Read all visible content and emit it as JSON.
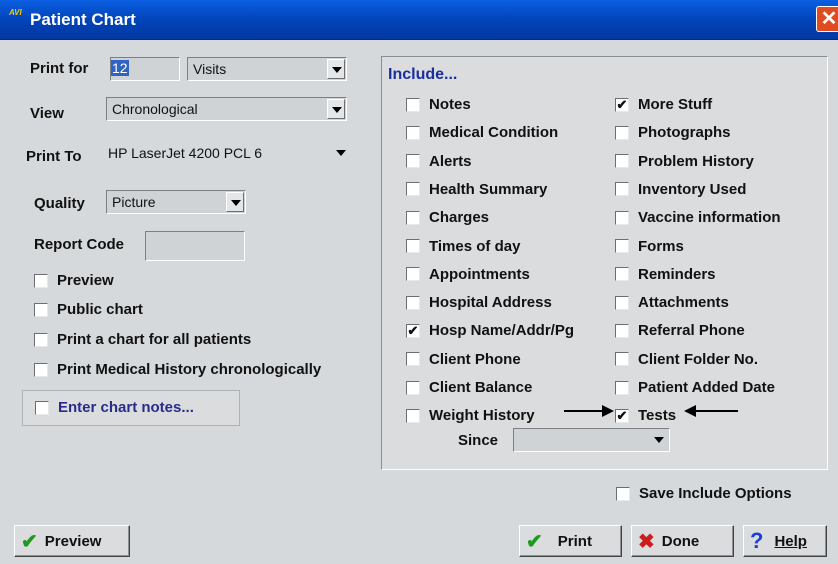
{
  "window": {
    "title": "Patient Chart",
    "app_badge": "AVI"
  },
  "left": {
    "print_for_label": "Print for",
    "print_for_value": "12",
    "print_for_unit": "Visits",
    "view_label": "View",
    "view_value": "Chronological",
    "print_to_label": "Print To",
    "print_to_value": "HP LaserJet 4200 PCL 6",
    "quality_label": "Quality",
    "quality_value": "Picture",
    "report_code_label": "Report Code",
    "options": [
      {
        "label": "Preview",
        "checked": false
      },
      {
        "label": "Public chart",
        "checked": false
      },
      {
        "label": "Print a chart for all patients",
        "checked": false
      },
      {
        "label": "Print Medical History chronologically",
        "checked": false
      }
    ],
    "enter_notes": {
      "label": "Enter chart notes...",
      "checked": false
    }
  },
  "include": {
    "heading": "Include...",
    "col1": [
      {
        "label": "Notes",
        "checked": false
      },
      {
        "label": "Medical Condition",
        "checked": false
      },
      {
        "label": "Alerts",
        "checked": false
      },
      {
        "label": "Health Summary",
        "checked": false
      },
      {
        "label": "Charges",
        "checked": false
      },
      {
        "label": "Times of day",
        "checked": false
      },
      {
        "label": "Appointments",
        "checked": false
      },
      {
        "label": "Hospital Address",
        "checked": false
      },
      {
        "label": "Hosp Name/Addr/Pg",
        "checked": true
      },
      {
        "label": "Client Phone",
        "checked": false
      },
      {
        "label": "Client Balance",
        "checked": false
      },
      {
        "label": "Weight History",
        "checked": false
      }
    ],
    "col2": [
      {
        "label": "More Stuff",
        "checked": true
      },
      {
        "label": "Photographs",
        "checked": false
      },
      {
        "label": "Problem History",
        "checked": false
      },
      {
        "label": "Inventory Used",
        "checked": false
      },
      {
        "label": "Vaccine information",
        "checked": false
      },
      {
        "label": "Forms",
        "checked": false
      },
      {
        "label": "Reminders",
        "checked": false
      },
      {
        "label": "Attachments",
        "checked": false
      },
      {
        "label": "Referral Phone",
        "checked": false
      },
      {
        "label": "Client Folder No.",
        "checked": false
      },
      {
        "label": "Patient Added Date",
        "checked": false
      },
      {
        "label": "Tests",
        "checked": true
      }
    ],
    "since_label": "Since",
    "since_value": ""
  },
  "save_include": {
    "label": "Save Include Options",
    "checked": false
  },
  "buttons": {
    "preview": "Preview",
    "print": "Print",
    "done": "Done",
    "help": "Help"
  },
  "icons": {
    "preview": "checkmark-icon",
    "print": "checkmark-icon",
    "done": "x-icon",
    "help": "question-icon"
  },
  "colors": {
    "titlebar": "#0550d0",
    "heading": "#1a2f9a",
    "notes_link": "#2a2c8c"
  }
}
